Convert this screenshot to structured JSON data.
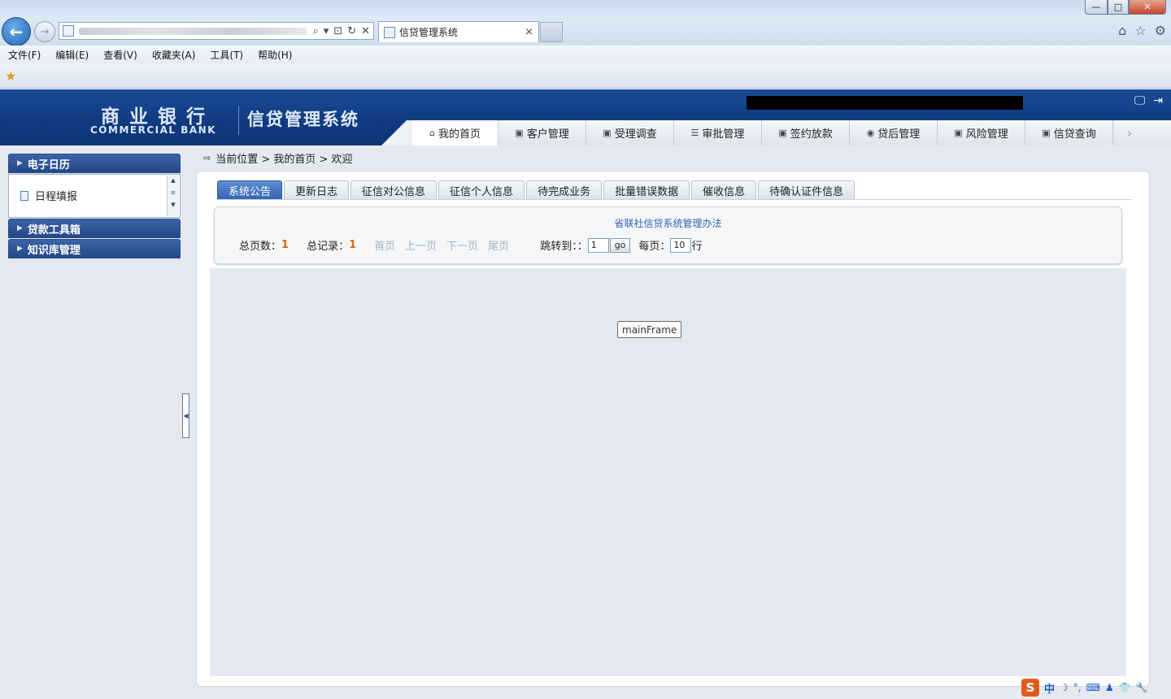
{
  "browser": {
    "tab_title": "信贷管理系统",
    "tab_close": "×",
    "menu": [
      "文件(F)",
      "编辑(E)",
      "查看(V)",
      "收藏夹(A)",
      "工具(T)",
      "帮助(H)"
    ],
    "window_buttons": {
      "minimize": "—",
      "maximize": "□",
      "close": "✕"
    },
    "address_tools": [
      "⌕",
      "▾",
      "⊡",
      "↻",
      "✕"
    ],
    "right_icons": [
      "⌂",
      "☆",
      "⚙"
    ]
  },
  "header": {
    "bank_cn": "商业银行",
    "bank_en": "COMMERCIAL BANK",
    "system_title": "信贷管理系统",
    "icons": [
      "🖵",
      "⇥"
    ]
  },
  "nav": {
    "items": [
      {
        "label": "我的首页",
        "icon": "⌂",
        "active": true
      },
      {
        "label": "客户管理",
        "icon": "▣"
      },
      {
        "label": "受理调查",
        "icon": "▣"
      },
      {
        "label": "审批管理",
        "icon": "☰"
      },
      {
        "label": "签约放款",
        "icon": "▣"
      },
      {
        "label": "贷后管理",
        "icon": "◉"
      },
      {
        "label": "风险管理",
        "icon": "▣"
      },
      {
        "label": "信贷查询",
        "icon": "▣"
      }
    ],
    "more": "›"
  },
  "sidebar": {
    "sections": [
      {
        "title": "电子日历",
        "items": [
          "日程填报"
        ]
      },
      {
        "title": "贷款工具箱"
      },
      {
        "title": "知识库管理"
      }
    ],
    "arrow": "▶",
    "scroll": [
      "▲",
      "≡",
      "▼"
    ],
    "splitter": "◀"
  },
  "breadcrumb": {
    "icon": "⇨",
    "text": "当前位置 > 我的首页 > 欢迎"
  },
  "content_tabs": [
    "系统公告",
    "更新日志",
    "征信对公信息",
    "征信个人信息",
    "待完成业务",
    "批量错误数据",
    "催收信息",
    "待确认证件信息"
  ],
  "notice": {
    "title": "省联社信贷系统管理办法",
    "pager": {
      "total_pages_label": "总页数：",
      "total_pages": "1",
      "total_records_label": "总记录：",
      "total_records": "1",
      "first": "首页",
      "prev": "上一页",
      "next": "下一页",
      "last": "尾页",
      "jump_label": "跳转到：：",
      "jump_value": "1",
      "go": "go",
      "per_page_label": "每页：",
      "per_page_value": "10",
      "per_page_unit": "行"
    }
  },
  "frame_label": "mainFrame",
  "ime": {
    "logo": "S",
    "lang": "中",
    "glyphs": [
      "☽",
      "°,",
      "⌨",
      "♟",
      "👕",
      "🔧"
    ]
  }
}
